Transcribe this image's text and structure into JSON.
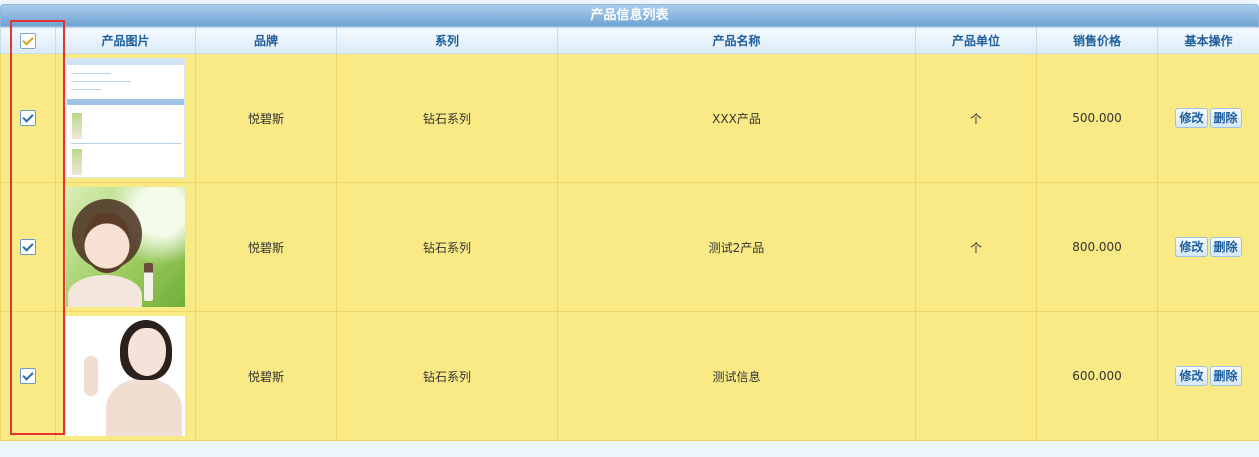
{
  "title": "产品信息列表",
  "columns": {
    "image": "产品图片",
    "brand": "品牌",
    "series": "系列",
    "name": "产品名称",
    "unit": "产品单位",
    "price": "销售价格",
    "ops": "基本操作"
  },
  "rows": [
    {
      "brand": "悦碧斯",
      "series": "钻石系列",
      "name": "XXX产品",
      "unit": "个",
      "price": "500.000",
      "checked": true,
      "image": "screenshot-thumbnail"
    },
    {
      "brand": "悦碧斯",
      "series": "钻石系列",
      "name": "测试2产品",
      "unit": "个",
      "price": "800.000",
      "checked": true,
      "image": "woman-green-background-photo"
    },
    {
      "brand": "悦碧斯",
      "series": "钻石系列",
      "name": "测试信息",
      "unit": "",
      "price": "600.000",
      "checked": true,
      "image": "woman-white-background-photo"
    }
  ],
  "actions": {
    "edit": "修改",
    "delete": "删除"
  },
  "colors": {
    "row_bg": "#faea86",
    "header_text": "#1e5f9c",
    "highlight": "#e3342f"
  }
}
